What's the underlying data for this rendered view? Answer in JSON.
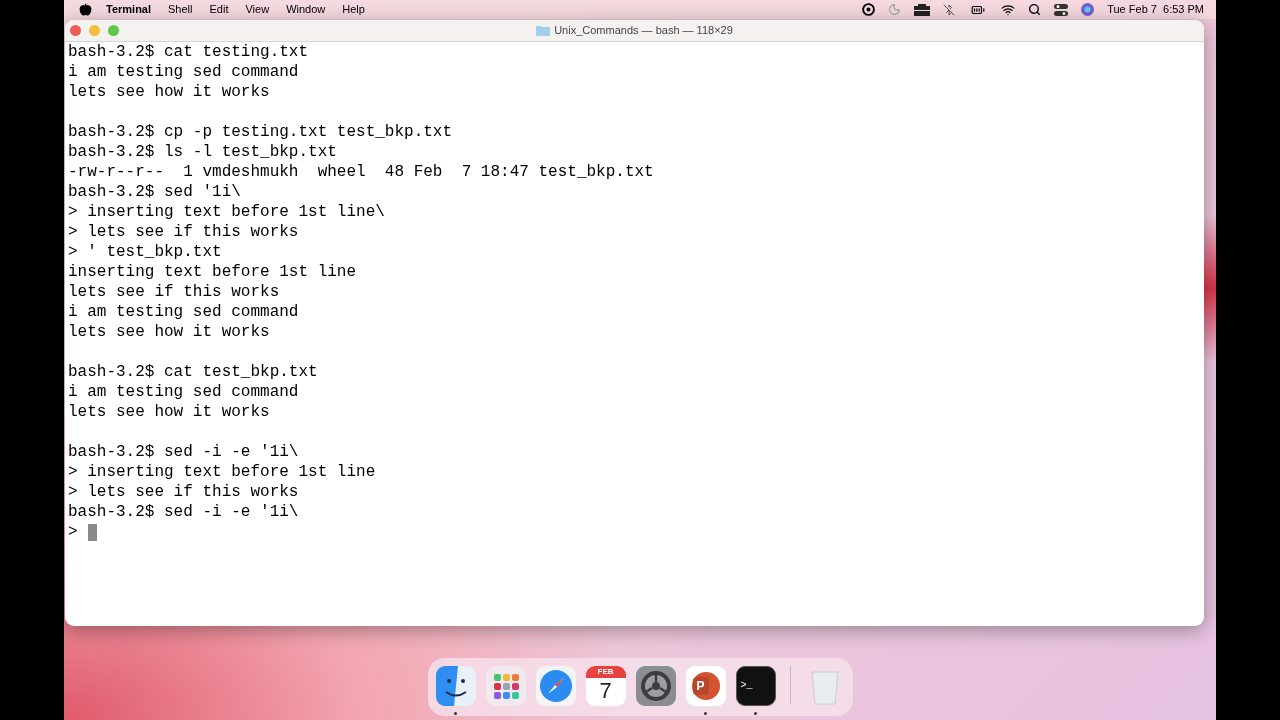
{
  "menu_bar": {
    "app_name": "Terminal",
    "menus": [
      "Shell",
      "Edit",
      "View",
      "Window",
      "Help"
    ],
    "clock": "Tue Feb 7  6:53 PM"
  },
  "window": {
    "title": "Unix_Commands — bash — 118×29"
  },
  "terminal": {
    "lines": [
      {
        "kind": "text",
        "text": "bash-3.2$ cat testing.txt"
      },
      {
        "kind": "text",
        "text": "i am testing sed command"
      },
      {
        "kind": "text",
        "text": "lets see how it works"
      },
      {
        "kind": "blank"
      },
      {
        "kind": "text",
        "text": "bash-3.2$ cp -p testing.txt test_bkp.txt"
      },
      {
        "kind": "text",
        "text": "bash-3.2$ ls -l test_bkp.txt"
      },
      {
        "kind": "text",
        "text": "-rw-r--r--  1 vmdeshmukh  wheel  48 Feb  7 18:47 test_bkp.txt"
      },
      {
        "kind": "text",
        "text": "bash-3.2$ sed '1i\\"
      },
      {
        "kind": "text",
        "text": "> inserting text before 1st line\\"
      },
      {
        "kind": "text",
        "text": "> lets see if this works"
      },
      {
        "kind": "text",
        "text": "> ' test_bkp.txt"
      },
      {
        "kind": "text",
        "text": "inserting text before 1st line"
      },
      {
        "kind": "text",
        "text": "lets see if this works"
      },
      {
        "kind": "text",
        "text": "i am testing sed command"
      },
      {
        "kind": "text",
        "text": "lets see how it works"
      },
      {
        "kind": "blank"
      },
      {
        "kind": "text",
        "text": "bash-3.2$ cat test_bkp.txt"
      },
      {
        "kind": "text",
        "text": "i am testing sed command"
      },
      {
        "kind": "text",
        "text": "lets see how it works"
      },
      {
        "kind": "blank"
      },
      {
        "kind": "text",
        "text": "bash-3.2$ sed -i -e '1i\\"
      },
      {
        "kind": "text",
        "text": "> inserting text before 1st line"
      },
      {
        "kind": "text",
        "text": "> lets see if this works"
      },
      {
        "kind": "text",
        "text": "bash-3.2$ sed -i -e '1i\\"
      },
      {
        "kind": "cursor",
        "text": ">"
      }
    ]
  },
  "dock": {
    "apps": [
      {
        "kind": "finder",
        "running": true
      },
      {
        "kind": "launchpad",
        "running": false
      },
      {
        "kind": "safari",
        "running": false
      },
      {
        "kind": "calendar",
        "running": false,
        "month": "FEB",
        "day": "7"
      },
      {
        "kind": "settings",
        "running": false
      },
      {
        "kind": "powerpoint",
        "running": true,
        "letter": "P"
      },
      {
        "kind": "terminal",
        "running": true,
        "prompt": ">_"
      },
      {
        "kind": "trash",
        "running": false
      }
    ]
  }
}
